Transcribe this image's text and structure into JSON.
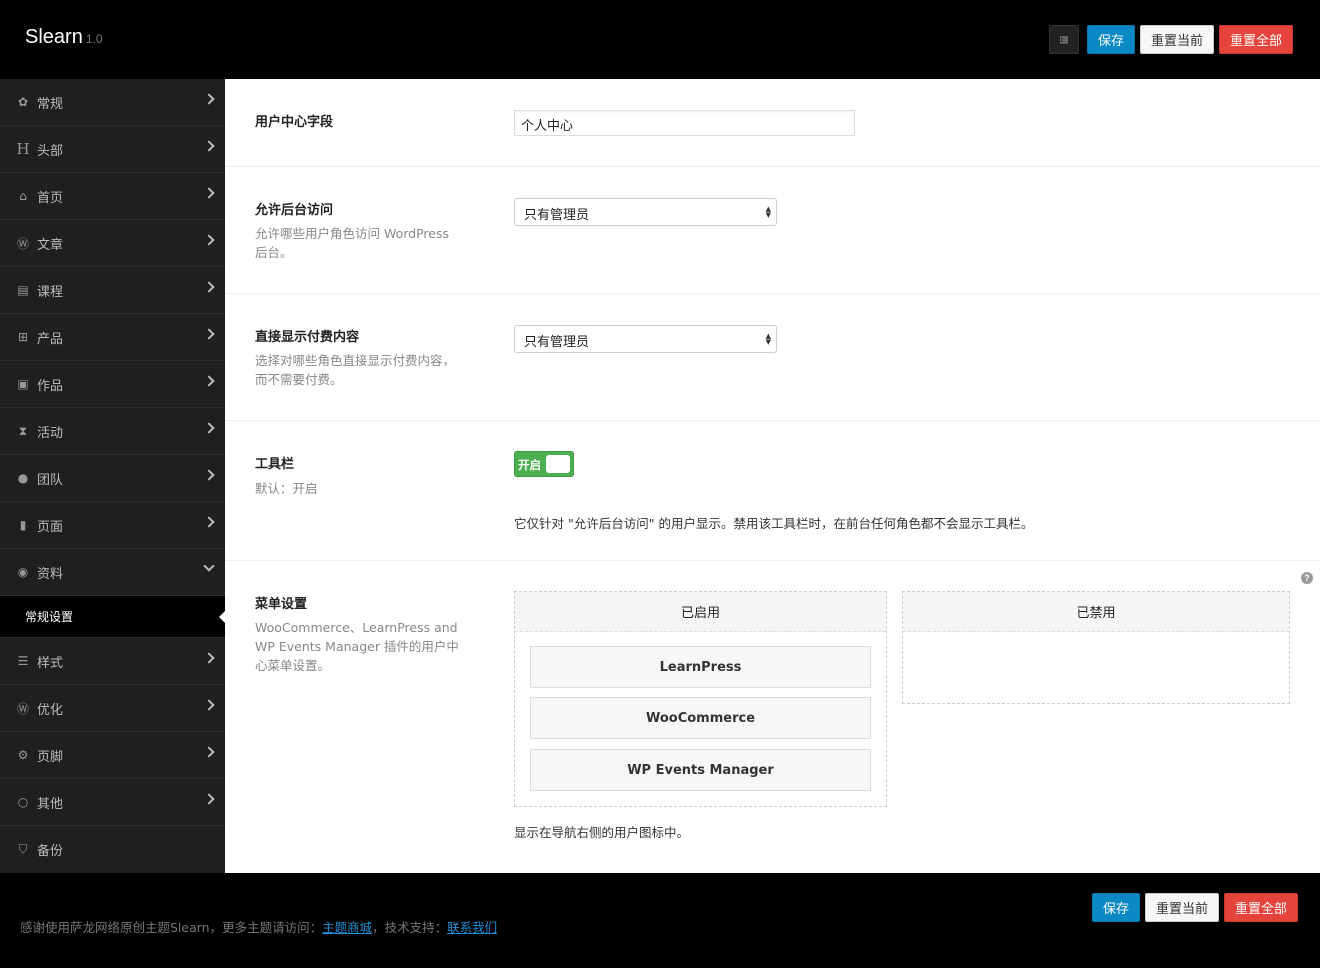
{
  "header": {
    "brand": "Slearn",
    "version": "1.0",
    "icon": "list-indent-icon",
    "save_label": "保存",
    "reset_current_label": "重置当前",
    "reset_all_label": "重置全部"
  },
  "sidebar": {
    "items": [
      {
        "label": "常规",
        "icon": "gear-icon"
      },
      {
        "label": "头部",
        "icon": "heading-icon"
      },
      {
        "label": "首页",
        "icon": "home-icon"
      },
      {
        "label": "文章",
        "icon": "wordpress-icon"
      },
      {
        "label": "课程",
        "icon": "book-icon"
      },
      {
        "label": "产品",
        "icon": "cart-icon"
      },
      {
        "label": "作品",
        "icon": "briefcase-icon"
      },
      {
        "label": "活动",
        "icon": "hourglass-icon"
      },
      {
        "label": "团队",
        "icon": "users-icon"
      },
      {
        "label": "页面",
        "icon": "file-icon"
      },
      {
        "label": "资料",
        "icon": "user-circle-icon"
      },
      {
        "label": "样式",
        "icon": "css3-icon"
      },
      {
        "label": "优化",
        "icon": "wordpress-icon"
      },
      {
        "label": "页脚",
        "icon": "cogs-icon"
      },
      {
        "label": "其他",
        "icon": "circle-icon"
      },
      {
        "label": "备份",
        "icon": "shield-icon"
      }
    ],
    "active_sub": "常规设置"
  },
  "fields": {
    "user_center": {
      "label": "用户中心字段",
      "value": "个人中心"
    },
    "backend_access": {
      "label": "允许后台访问",
      "desc": "允许哪些用户角色访问 WordPress 后台。",
      "value": "只有管理员"
    },
    "paid_content": {
      "label": "直接显示付费内容",
      "desc": "选择对哪些角色直接显示付费内容，而不需要付费。",
      "value": "只有管理员"
    },
    "toolbar": {
      "label": "工具栏",
      "desc": "默认：开启",
      "toggle_label": "开启",
      "toggle_on": true,
      "note": "它仅针对 \"允许后台访问\" 的用户显示。禁用该工具栏时，在前台任何角色都不会显示工具栏。"
    },
    "menu": {
      "label": "菜单设置",
      "desc": "WooCommerce、LearnPress and WP Events Manager 插件的用户中心菜单设置。",
      "enabled_title": "已启用",
      "disabled_title": "已禁用",
      "enabled_items": [
        "LearnPress",
        "WooCommerce",
        "WP Events Manager"
      ],
      "note": "显示在导航右侧的用户图标中。"
    }
  },
  "footer": {
    "text_prefix": "感谢使用萨龙网络原创主题Slearn，更多主题请访问：",
    "link_store": "主题商城",
    "text_mid": "，技术支持：",
    "link_contact": "联系我们",
    "save_label": "保存",
    "reset_current_label": "重置当前",
    "reset_all_label": "重置全部"
  },
  "colors": {
    "accent": "#0a89c5",
    "danger": "#e4443c",
    "toggle": "#4caf50",
    "link": "#1e8fd6"
  }
}
